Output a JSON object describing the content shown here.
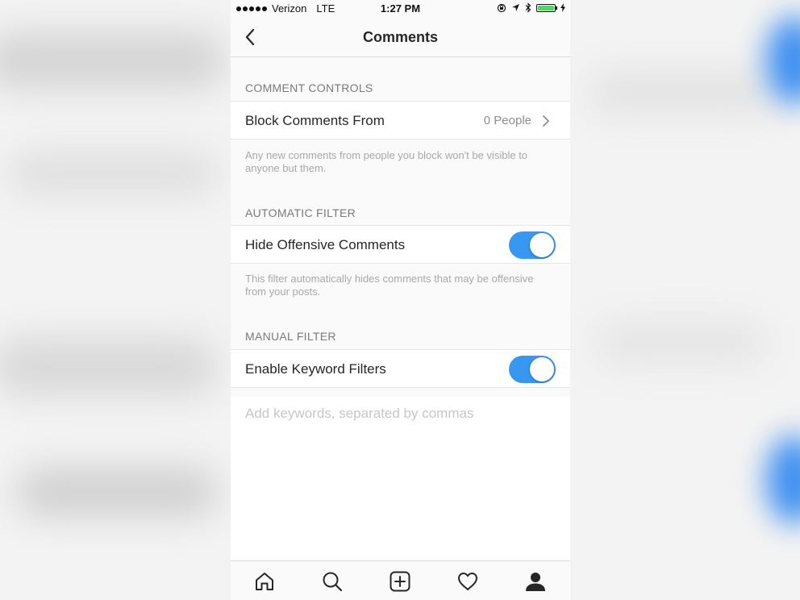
{
  "status_bar": {
    "carrier": "Verizon",
    "network": "LTE",
    "time": "1:27 PM"
  },
  "nav": {
    "title": "Comments"
  },
  "comment_controls": {
    "header": "COMMENT CONTROLS",
    "block_row": {
      "label": "Block Comments From",
      "value": "0 People"
    },
    "note": "Any new comments from people you block won't be visible to anyone but them."
  },
  "automatic_filter": {
    "header": "AUTOMATIC FILTER",
    "row": {
      "label": "Hide Offensive Comments",
      "enabled": true
    },
    "note": "This filter automatically hides comments that may be offensive from your posts."
  },
  "manual_filter": {
    "header": "MANUAL FILTER",
    "row": {
      "label": "Enable Keyword Filters",
      "enabled": true
    },
    "keywords_placeholder": "Add keywords, separated by commas",
    "keywords_value": ""
  },
  "tab_bar": {
    "items": [
      "home-icon",
      "search-icon",
      "add-post-icon",
      "heart-icon",
      "profile-icon"
    ],
    "active": "profile-icon"
  },
  "colors": {
    "accent": "#3897f0",
    "toggle_on": "#3897f0",
    "background": "#fafafa",
    "text_primary": "#262626",
    "text_secondary": "#8e8e8e"
  }
}
